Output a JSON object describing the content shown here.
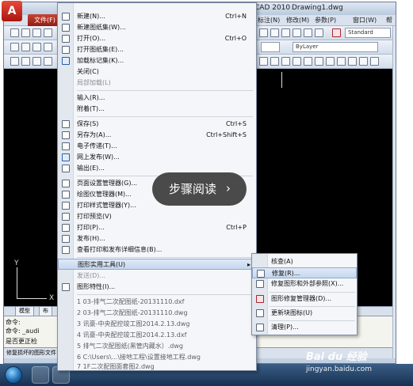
{
  "window": {
    "logo_text": "A",
    "title": "CAD 2010",
    "drawing_name": "Drawing1.dwg"
  },
  "menubar": {
    "file_tab": "文件(F)",
    "items": [
      "标注(N)",
      "修改(M)",
      "参数(P)",
      "窗口(W)",
      "帮"
    ]
  },
  "toolbar": {
    "text_style": "Standard",
    "layer_combo": "ByLayer"
  },
  "app_menu": {
    "items": [
      {
        "label": "新建(N)...",
        "shortcut": "Ctrl+N"
      },
      {
        "label": "新建图纸集(W)...",
        "shortcut": ""
      },
      {
        "label": "打开(O)...",
        "shortcut": "Ctrl+O"
      },
      {
        "label": "打开图纸集(E)...",
        "shortcut": ""
      },
      {
        "label": "加载标记集(K)...",
        "shortcut": ""
      },
      {
        "label": "关闭(C)",
        "shortcut": ""
      },
      {
        "label": "局部加载(L)",
        "shortcut": ""
      },
      {
        "label": "输入(R)...",
        "shortcut": ""
      },
      {
        "label": "附着(T)...",
        "shortcut": ""
      },
      {
        "label": "保存(S)",
        "shortcut": "Ctrl+S"
      },
      {
        "label": "另存为(A)...",
        "shortcut": "Ctrl+Shift+S"
      },
      {
        "label": "电子传递(T)...",
        "shortcut": ""
      },
      {
        "label": "网上发布(W)...",
        "shortcut": ""
      },
      {
        "label": "输出(E)...",
        "shortcut": ""
      },
      {
        "label": "页面设置管理器(G)...",
        "shortcut": ""
      },
      {
        "label": "绘图仪管理器(M)...",
        "shortcut": ""
      },
      {
        "label": "打印样式管理器(Y)...",
        "shortcut": ""
      },
      {
        "label": "打印预览(V)",
        "shortcut": ""
      },
      {
        "label": "打印(P)...",
        "shortcut": "Ctrl+P"
      },
      {
        "label": "发布(H)...",
        "shortcut": ""
      },
      {
        "label": "查看打印和发布详细信息(B)...",
        "shortcut": ""
      },
      {
        "label": "图形实用工具(U)",
        "shortcut": ""
      },
      {
        "label": "发送(D)...",
        "shortcut": ""
      },
      {
        "label": "图形特性(I)...",
        "shortcut": ""
      }
    ],
    "recent_files": [
      "1 03-排气二次配图纸-20131110.dxf",
      "2 03-排气二次配图纸-20131110.dwg",
      "3 讯豪-中央配控竣工图2014.2.13.dwg",
      "4 讯豪-中央配控竣工图2014.2.13.dxf",
      "5 排气二次配图纸(黑管内藏水）.dwg",
      "6 C:\\Users\\...\\接地工程\\设置接地工程.dwg",
      "7 1F二次配图面套图2.dwg"
    ],
    "more_arrow": "▾"
  },
  "sub_menu": {
    "items": [
      {
        "label": "核查(A)"
      },
      {
        "label": "修复(R)..."
      },
      {
        "label": "修复图形和外部参照(X)..."
      },
      {
        "label": "图形修复管理器(D)..."
      },
      {
        "label": "更新块图标(U)"
      },
      {
        "label": "清理(P)..."
      }
    ]
  },
  "drawing": {
    "ucs_y": "Y",
    "ucs_x": "X"
  },
  "model_tabs": [
    "模型",
    "布"
  ],
  "command": {
    "lines": [
      "命令:",
      "命令:  _audi",
      "是否更正检"
    ],
    "status_text": "修复损坏的图形文件"
  },
  "read_pill": {
    "text": "步骤阅读",
    "arrow": "›"
  },
  "watermark": {
    "logo": "Bai du 经验",
    "url": "jingyan.baidu.com"
  },
  "colors": {
    "accent_red": "#b42a1d",
    "highlight": "#c6d7ee",
    "canvas": "#000000"
  }
}
